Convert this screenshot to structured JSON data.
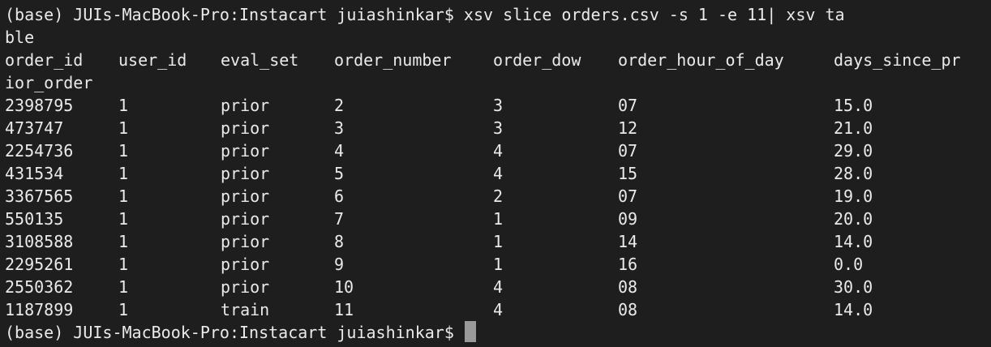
{
  "terminal": {
    "command_line_1": "(base) JUIs-MacBook-Pro:Instacart juiashinkar$ xsv slice orders.csv -s 1 -e 11| xsv ta",
    "command_line_2": "ble",
    "header": {
      "order_id": "order_id",
      "user_id": "user_id",
      "eval_set": "eval_set",
      "order_number": "order_number",
      "order_dow": "order_dow",
      "order_hour_of_day": "order_hour_of_day",
      "days_since_prior_order": "days_since_pr",
      "wrap": "ior_order"
    },
    "rows": [
      [
        "2398795",
        "1",
        "prior",
        "2",
        "3",
        "07",
        "15.0"
      ],
      [
        "473747",
        "1",
        "prior",
        "3",
        "3",
        "12",
        "21.0"
      ],
      [
        "2254736",
        "1",
        "prior",
        "4",
        "4",
        "07",
        "29.0"
      ],
      [
        "431534",
        "1",
        "prior",
        "5",
        "4",
        "15",
        "28.0"
      ],
      [
        "3367565",
        "1",
        "prior",
        "6",
        "2",
        "07",
        "19.0"
      ],
      [
        "550135",
        "1",
        "prior",
        "7",
        "1",
        "09",
        "20.0"
      ],
      [
        "3108588",
        "1",
        "prior",
        "8",
        "1",
        "14",
        "14.0"
      ],
      [
        "2295261",
        "1",
        "prior",
        "9",
        "1",
        "16",
        "0.0"
      ],
      [
        "2550362",
        "1",
        "prior",
        "10",
        "4",
        "08",
        "30.0"
      ],
      [
        "1187899",
        "1",
        "train",
        "11",
        "4",
        "08",
        "14.0"
      ]
    ],
    "prompt": "(base) JUIs-MacBook-Pro:Instacart juiashinkar$",
    "background_color": "#1e1e1e",
    "text_color": "#eaeaea",
    "cursor_color": "#9a9a9a"
  }
}
